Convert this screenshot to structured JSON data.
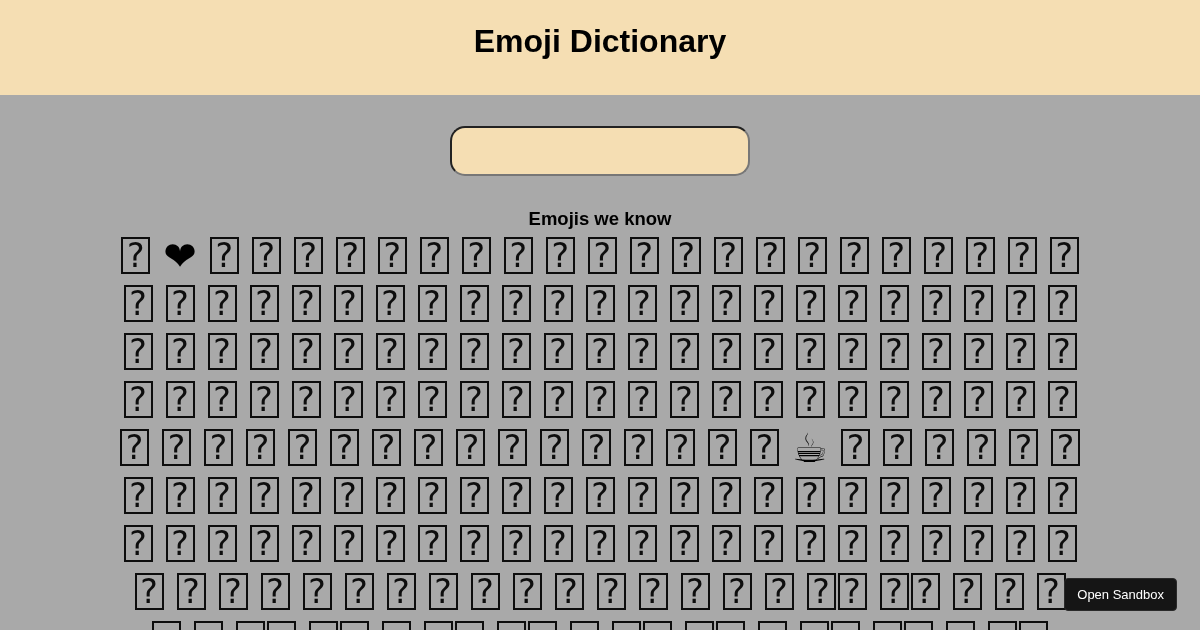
{
  "header": {
    "title": "Emoji Dictionary"
  },
  "emoji_list": {
    "heading": "Emojis we know",
    "items": [
      {
        "kind": "missing",
        "glyphs": [
          "?"
        ]
      },
      {
        "kind": "emoji",
        "glyphs": [
          "❤"
        ]
      },
      {
        "kind": "missing",
        "glyphs": [
          "?"
        ]
      },
      {
        "kind": "missing",
        "glyphs": [
          "?"
        ]
      },
      {
        "kind": "missing",
        "glyphs": [
          "?"
        ]
      },
      {
        "kind": "missing",
        "glyphs": [
          "?"
        ]
      },
      {
        "kind": "missing",
        "glyphs": [
          "?"
        ]
      },
      {
        "kind": "missing",
        "glyphs": [
          "?"
        ]
      },
      {
        "kind": "missing",
        "glyphs": [
          "?"
        ]
      },
      {
        "kind": "missing",
        "glyphs": [
          "?"
        ]
      },
      {
        "kind": "missing",
        "glyphs": [
          "?"
        ]
      },
      {
        "kind": "missing",
        "glyphs": [
          "?"
        ]
      },
      {
        "kind": "missing",
        "glyphs": [
          "?"
        ]
      },
      {
        "kind": "missing",
        "glyphs": [
          "?"
        ]
      },
      {
        "kind": "missing",
        "glyphs": [
          "?"
        ]
      },
      {
        "kind": "missing",
        "glyphs": [
          "?"
        ]
      },
      {
        "kind": "missing",
        "glyphs": [
          "?"
        ]
      },
      {
        "kind": "missing",
        "glyphs": [
          "?"
        ]
      },
      {
        "kind": "missing",
        "glyphs": [
          "?"
        ]
      },
      {
        "kind": "missing",
        "glyphs": [
          "?"
        ]
      },
      {
        "kind": "missing",
        "glyphs": [
          "?"
        ]
      },
      {
        "kind": "missing",
        "glyphs": [
          "?"
        ]
      },
      {
        "kind": "missing",
        "glyphs": [
          "?"
        ]
      },
      {
        "kind": "missing",
        "glyphs": [
          "?"
        ]
      },
      {
        "kind": "missing",
        "glyphs": [
          "?"
        ]
      },
      {
        "kind": "missing",
        "glyphs": [
          "?"
        ]
      },
      {
        "kind": "missing",
        "glyphs": [
          "?"
        ]
      },
      {
        "kind": "missing",
        "glyphs": [
          "?"
        ]
      },
      {
        "kind": "missing",
        "glyphs": [
          "?"
        ]
      },
      {
        "kind": "missing",
        "glyphs": [
          "?"
        ]
      },
      {
        "kind": "missing",
        "glyphs": [
          "?"
        ]
      },
      {
        "kind": "missing",
        "glyphs": [
          "?"
        ]
      },
      {
        "kind": "missing",
        "glyphs": [
          "?"
        ]
      },
      {
        "kind": "missing",
        "glyphs": [
          "?"
        ]
      },
      {
        "kind": "missing",
        "glyphs": [
          "?"
        ]
      },
      {
        "kind": "missing",
        "glyphs": [
          "?"
        ]
      },
      {
        "kind": "missing",
        "glyphs": [
          "?"
        ]
      },
      {
        "kind": "missing",
        "glyphs": [
          "?"
        ]
      },
      {
        "kind": "missing",
        "glyphs": [
          "?"
        ]
      },
      {
        "kind": "missing",
        "glyphs": [
          "?"
        ]
      },
      {
        "kind": "missing",
        "glyphs": [
          "?"
        ]
      },
      {
        "kind": "missing",
        "glyphs": [
          "?"
        ]
      },
      {
        "kind": "missing",
        "glyphs": [
          "?"
        ]
      },
      {
        "kind": "missing",
        "glyphs": [
          "?"
        ]
      },
      {
        "kind": "missing",
        "glyphs": [
          "?"
        ]
      },
      {
        "kind": "missing",
        "glyphs": [
          "?"
        ]
      },
      {
        "kind": "missing",
        "glyphs": [
          "?"
        ]
      },
      {
        "kind": "missing",
        "glyphs": [
          "?"
        ]
      },
      {
        "kind": "missing",
        "glyphs": [
          "?"
        ]
      },
      {
        "kind": "missing",
        "glyphs": [
          "?"
        ]
      },
      {
        "kind": "missing",
        "glyphs": [
          "?"
        ]
      },
      {
        "kind": "missing",
        "glyphs": [
          "?"
        ]
      },
      {
        "kind": "missing",
        "glyphs": [
          "?"
        ]
      },
      {
        "kind": "missing",
        "glyphs": [
          "?"
        ]
      },
      {
        "kind": "missing",
        "glyphs": [
          "?"
        ]
      },
      {
        "kind": "missing",
        "glyphs": [
          "?"
        ]
      },
      {
        "kind": "missing",
        "glyphs": [
          "?"
        ]
      },
      {
        "kind": "missing",
        "glyphs": [
          "?"
        ]
      },
      {
        "kind": "missing",
        "glyphs": [
          "?"
        ]
      },
      {
        "kind": "missing",
        "glyphs": [
          "?"
        ]
      },
      {
        "kind": "missing",
        "glyphs": [
          "?"
        ]
      },
      {
        "kind": "missing",
        "glyphs": [
          "?"
        ]
      },
      {
        "kind": "missing",
        "glyphs": [
          "?"
        ]
      },
      {
        "kind": "missing",
        "glyphs": [
          "?"
        ]
      },
      {
        "kind": "missing",
        "glyphs": [
          "?"
        ]
      },
      {
        "kind": "missing",
        "glyphs": [
          "?"
        ]
      },
      {
        "kind": "missing",
        "glyphs": [
          "?"
        ]
      },
      {
        "kind": "missing",
        "glyphs": [
          "?"
        ]
      },
      {
        "kind": "missing",
        "glyphs": [
          "?"
        ]
      },
      {
        "kind": "missing",
        "glyphs": [
          "?"
        ]
      },
      {
        "kind": "missing",
        "glyphs": [
          "?"
        ]
      },
      {
        "kind": "missing",
        "glyphs": [
          "?"
        ]
      },
      {
        "kind": "missing",
        "glyphs": [
          "?"
        ]
      },
      {
        "kind": "missing",
        "glyphs": [
          "?"
        ]
      },
      {
        "kind": "missing",
        "glyphs": [
          "?"
        ]
      },
      {
        "kind": "missing",
        "glyphs": [
          "?"
        ]
      },
      {
        "kind": "missing",
        "glyphs": [
          "?"
        ]
      },
      {
        "kind": "missing",
        "glyphs": [
          "?"
        ]
      },
      {
        "kind": "missing",
        "glyphs": [
          "?"
        ]
      },
      {
        "kind": "missing",
        "glyphs": [
          "?"
        ]
      },
      {
        "kind": "missing",
        "glyphs": [
          "?"
        ]
      },
      {
        "kind": "missing",
        "glyphs": [
          "?"
        ]
      },
      {
        "kind": "missing",
        "glyphs": [
          "?"
        ]
      },
      {
        "kind": "missing",
        "glyphs": [
          "?"
        ]
      },
      {
        "kind": "missing",
        "glyphs": [
          "?"
        ]
      },
      {
        "kind": "missing",
        "glyphs": [
          "?"
        ]
      },
      {
        "kind": "missing",
        "glyphs": [
          "?"
        ]
      },
      {
        "kind": "missing",
        "glyphs": [
          "?"
        ]
      },
      {
        "kind": "missing",
        "glyphs": [
          "?"
        ]
      },
      {
        "kind": "missing",
        "glyphs": [
          "?"
        ]
      },
      {
        "kind": "missing",
        "glyphs": [
          "?"
        ]
      },
      {
        "kind": "missing",
        "glyphs": [
          "?"
        ]
      },
      {
        "kind": "missing",
        "glyphs": [
          "?"
        ]
      },
      {
        "kind": "missing",
        "glyphs": [
          "?"
        ]
      },
      {
        "kind": "missing",
        "glyphs": [
          "?"
        ]
      },
      {
        "kind": "missing",
        "glyphs": [
          "?"
        ]
      },
      {
        "kind": "missing",
        "glyphs": [
          "?"
        ]
      },
      {
        "kind": "missing",
        "glyphs": [
          "?"
        ]
      },
      {
        "kind": "missing",
        "glyphs": [
          "?"
        ]
      },
      {
        "kind": "missing",
        "glyphs": [
          "?"
        ]
      },
      {
        "kind": "missing",
        "glyphs": [
          "?"
        ]
      },
      {
        "kind": "missing",
        "glyphs": [
          "?"
        ]
      },
      {
        "kind": "missing",
        "glyphs": [
          "?"
        ]
      },
      {
        "kind": "missing",
        "glyphs": [
          "?"
        ]
      },
      {
        "kind": "missing",
        "glyphs": [
          "?"
        ]
      },
      {
        "kind": "missing",
        "glyphs": [
          "?"
        ]
      },
      {
        "kind": "missing",
        "glyphs": [
          "?"
        ]
      },
      {
        "kind": "missing",
        "glyphs": [
          "?"
        ]
      },
      {
        "kind": "emoji",
        "glyphs": [
          "☕"
        ]
      },
      {
        "kind": "missing",
        "glyphs": [
          "?"
        ]
      },
      {
        "kind": "missing",
        "glyphs": [
          "?"
        ]
      },
      {
        "kind": "missing",
        "glyphs": [
          "?"
        ]
      },
      {
        "kind": "missing",
        "glyphs": [
          "?"
        ]
      },
      {
        "kind": "missing",
        "glyphs": [
          "?"
        ]
      },
      {
        "kind": "missing",
        "glyphs": [
          "?"
        ]
      },
      {
        "kind": "missing",
        "glyphs": [
          "?"
        ]
      },
      {
        "kind": "missing",
        "glyphs": [
          "?"
        ]
      },
      {
        "kind": "missing",
        "glyphs": [
          "?"
        ]
      },
      {
        "kind": "missing",
        "glyphs": [
          "?"
        ]
      },
      {
        "kind": "missing",
        "glyphs": [
          "?"
        ]
      },
      {
        "kind": "missing",
        "glyphs": [
          "?"
        ]
      },
      {
        "kind": "missing",
        "glyphs": [
          "?"
        ]
      },
      {
        "kind": "missing",
        "glyphs": [
          "?"
        ]
      },
      {
        "kind": "missing",
        "glyphs": [
          "?"
        ]
      },
      {
        "kind": "missing",
        "glyphs": [
          "?"
        ]
      },
      {
        "kind": "missing",
        "glyphs": [
          "?"
        ]
      },
      {
        "kind": "missing",
        "glyphs": [
          "?"
        ]
      },
      {
        "kind": "missing",
        "glyphs": [
          "?"
        ]
      },
      {
        "kind": "missing",
        "glyphs": [
          "?"
        ]
      },
      {
        "kind": "missing",
        "glyphs": [
          "?"
        ]
      },
      {
        "kind": "missing",
        "glyphs": [
          "?"
        ]
      },
      {
        "kind": "missing",
        "glyphs": [
          "?"
        ]
      },
      {
        "kind": "missing",
        "glyphs": [
          "?"
        ]
      },
      {
        "kind": "missing",
        "glyphs": [
          "?"
        ]
      },
      {
        "kind": "missing",
        "glyphs": [
          "?"
        ]
      },
      {
        "kind": "missing",
        "glyphs": [
          "?"
        ]
      },
      {
        "kind": "missing",
        "glyphs": [
          "?"
        ]
      },
      {
        "kind": "missing",
        "glyphs": [
          "?"
        ]
      },
      {
        "kind": "missing",
        "glyphs": [
          "?"
        ]
      },
      {
        "kind": "missing",
        "glyphs": [
          "?"
        ]
      },
      {
        "kind": "missing",
        "glyphs": [
          "?"
        ]
      },
      {
        "kind": "missing",
        "glyphs": [
          "?"
        ]
      },
      {
        "kind": "missing",
        "glyphs": [
          "?"
        ]
      },
      {
        "kind": "missing",
        "glyphs": [
          "?"
        ]
      },
      {
        "kind": "missing",
        "glyphs": [
          "?"
        ]
      },
      {
        "kind": "missing",
        "glyphs": [
          "?"
        ]
      },
      {
        "kind": "missing",
        "glyphs": [
          "?"
        ]
      },
      {
        "kind": "missing",
        "glyphs": [
          "?"
        ]
      },
      {
        "kind": "missing",
        "glyphs": [
          "?"
        ]
      },
      {
        "kind": "missing",
        "glyphs": [
          "?"
        ]
      },
      {
        "kind": "missing",
        "glyphs": [
          "?"
        ]
      },
      {
        "kind": "missing",
        "glyphs": [
          "?"
        ]
      },
      {
        "kind": "missing",
        "glyphs": [
          "?"
        ]
      },
      {
        "kind": "missing",
        "glyphs": [
          "?"
        ]
      },
      {
        "kind": "missing",
        "glyphs": [
          "?"
        ]
      },
      {
        "kind": "missing",
        "glyphs": [
          "?"
        ]
      },
      {
        "kind": "missing",
        "glyphs": [
          "?"
        ]
      },
      {
        "kind": "missing",
        "glyphs": [
          "?"
        ]
      },
      {
        "kind": "missing",
        "glyphs": [
          "?"
        ]
      },
      {
        "kind": "missing",
        "glyphs": [
          "?"
        ]
      },
      {
        "kind": "missing",
        "glyphs": [
          "?"
        ]
      },
      {
        "kind": "missing",
        "glyphs": [
          "?"
        ]
      },
      {
        "kind": "missing",
        "glyphs": [
          "?"
        ]
      },
      {
        "kind": "missing",
        "glyphs": [
          "?"
        ]
      },
      {
        "kind": "missing",
        "glyphs": [
          "?"
        ]
      },
      {
        "kind": "missing",
        "glyphs": [
          "?"
        ]
      },
      {
        "kind": "missing",
        "glyphs": [
          "?"
        ]
      },
      {
        "kind": "missing",
        "glyphs": [
          "?"
        ]
      },
      {
        "kind": "missing",
        "glyphs": [
          "?"
        ]
      },
      {
        "kind": "missing",
        "glyphs": [
          "?"
        ]
      },
      {
        "kind": "missing",
        "glyphs": [
          "?"
        ]
      },
      {
        "kind": "missing",
        "glyphs": [
          "?"
        ]
      },
      {
        "kind": "missing",
        "glyphs": [
          "?"
        ]
      },
      {
        "kind": "missing",
        "glyphs": [
          "?"
        ]
      },
      {
        "kind": "missing",
        "glyphs": [
          "?"
        ]
      },
      {
        "kind": "missing",
        "glyphs": [
          "?"
        ]
      },
      {
        "kind": "missing",
        "glyphs": [
          "?"
        ]
      },
      {
        "kind": "missing",
        "glyphs": [
          "?",
          "?"
        ]
      },
      {
        "kind": "missing",
        "glyphs": [
          "?",
          "?"
        ]
      },
      {
        "kind": "missing",
        "glyphs": [
          "?"
        ]
      },
      {
        "kind": "missing",
        "glyphs": [
          "?"
        ]
      },
      {
        "kind": "missing",
        "glyphs": [
          "?"
        ]
      },
      {
        "kind": "cut",
        "double": false
      },
      {
        "kind": "cut",
        "double": false
      },
      {
        "kind": "cut",
        "double": true
      },
      {
        "kind": "cut",
        "double": true
      },
      {
        "kind": "cut",
        "double": false
      },
      {
        "kind": "cut",
        "double": true
      },
      {
        "kind": "cut",
        "double": true
      },
      {
        "kind": "cut",
        "double": false
      },
      {
        "kind": "cut",
        "double": true
      },
      {
        "kind": "cut",
        "double": true
      },
      {
        "kind": "cut",
        "double": false
      },
      {
        "kind": "cut",
        "double": true
      },
      {
        "kind": "cut",
        "double": true
      },
      {
        "kind": "cut",
        "double": false
      },
      {
        "kind": "cut",
        "double": true
      }
    ]
  },
  "sandbox_button": {
    "label": "Open Sandbox"
  }
}
